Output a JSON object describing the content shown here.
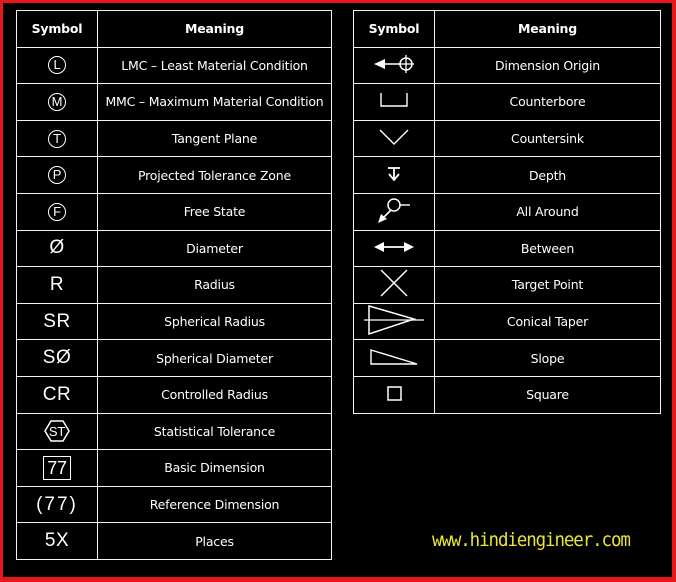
{
  "tables": {
    "left": {
      "headers": {
        "symbol": "Symbol",
        "meaning": "Meaning"
      },
      "rows": [
        {
          "symbol": "L",
          "icon": "circled-l-icon",
          "meaning": "LMC – Least Material Condition"
        },
        {
          "symbol": "M",
          "icon": "circled-m-icon",
          "meaning": "MMC – Maximum Material Condition"
        },
        {
          "symbol": "T",
          "icon": "circled-t-icon",
          "meaning": "Tangent Plane"
        },
        {
          "symbol": "P",
          "icon": "circled-p-icon",
          "meaning": "Projected Tolerance Zone"
        },
        {
          "symbol": "F",
          "icon": "circled-f-icon",
          "meaning": "Free State"
        },
        {
          "symbol": "Ø",
          "icon": "diameter-icon",
          "meaning": "Diameter"
        },
        {
          "symbol": "R",
          "icon": "radius-icon",
          "meaning": "Radius"
        },
        {
          "symbol": "SR",
          "icon": "spherical-radius-icon",
          "meaning": "Spherical Radius"
        },
        {
          "symbol": "SØ",
          "icon": "spherical-diameter-icon",
          "meaning": "Spherical Diameter"
        },
        {
          "symbol": "CR",
          "icon": "controlled-radius-icon",
          "meaning": "Controlled Radius"
        },
        {
          "symbol": "ST",
          "icon": "statistical-tolerance-icon",
          "meaning": "Statistical Tolerance"
        },
        {
          "symbol": "77",
          "icon": "basic-dimension-icon",
          "meaning": "Basic Dimension"
        },
        {
          "symbol": "(77)",
          "icon": "reference-dimension-icon",
          "meaning": "Reference Dimension"
        },
        {
          "symbol": "5X",
          "icon": "places-icon",
          "meaning": "Places"
        }
      ]
    },
    "right": {
      "headers": {
        "symbol": "Symbol",
        "meaning": "Meaning"
      },
      "rows": [
        {
          "icon": "dimension-origin-icon",
          "meaning": "Dimension Origin"
        },
        {
          "icon": "counterbore-icon",
          "meaning": "Counterbore"
        },
        {
          "icon": "countersink-icon",
          "meaning": "Countersink"
        },
        {
          "icon": "depth-icon",
          "meaning": "Depth"
        },
        {
          "icon": "all-around-icon",
          "meaning": "All Around"
        },
        {
          "icon": "between-icon",
          "meaning": "Between"
        },
        {
          "icon": "target-point-icon",
          "meaning": "Target Point"
        },
        {
          "icon": "conical-taper-icon",
          "meaning": "Conical Taper"
        },
        {
          "icon": "slope-icon",
          "meaning": "Slope"
        },
        {
          "icon": "square-icon",
          "meaning": "Square"
        }
      ]
    }
  },
  "watermark": "www.hindiengineer.com",
  "colors": {
    "frame": "#e8171c",
    "background": "#000000",
    "lines": "#f4f4f4",
    "watermark": "#e8e436"
  }
}
